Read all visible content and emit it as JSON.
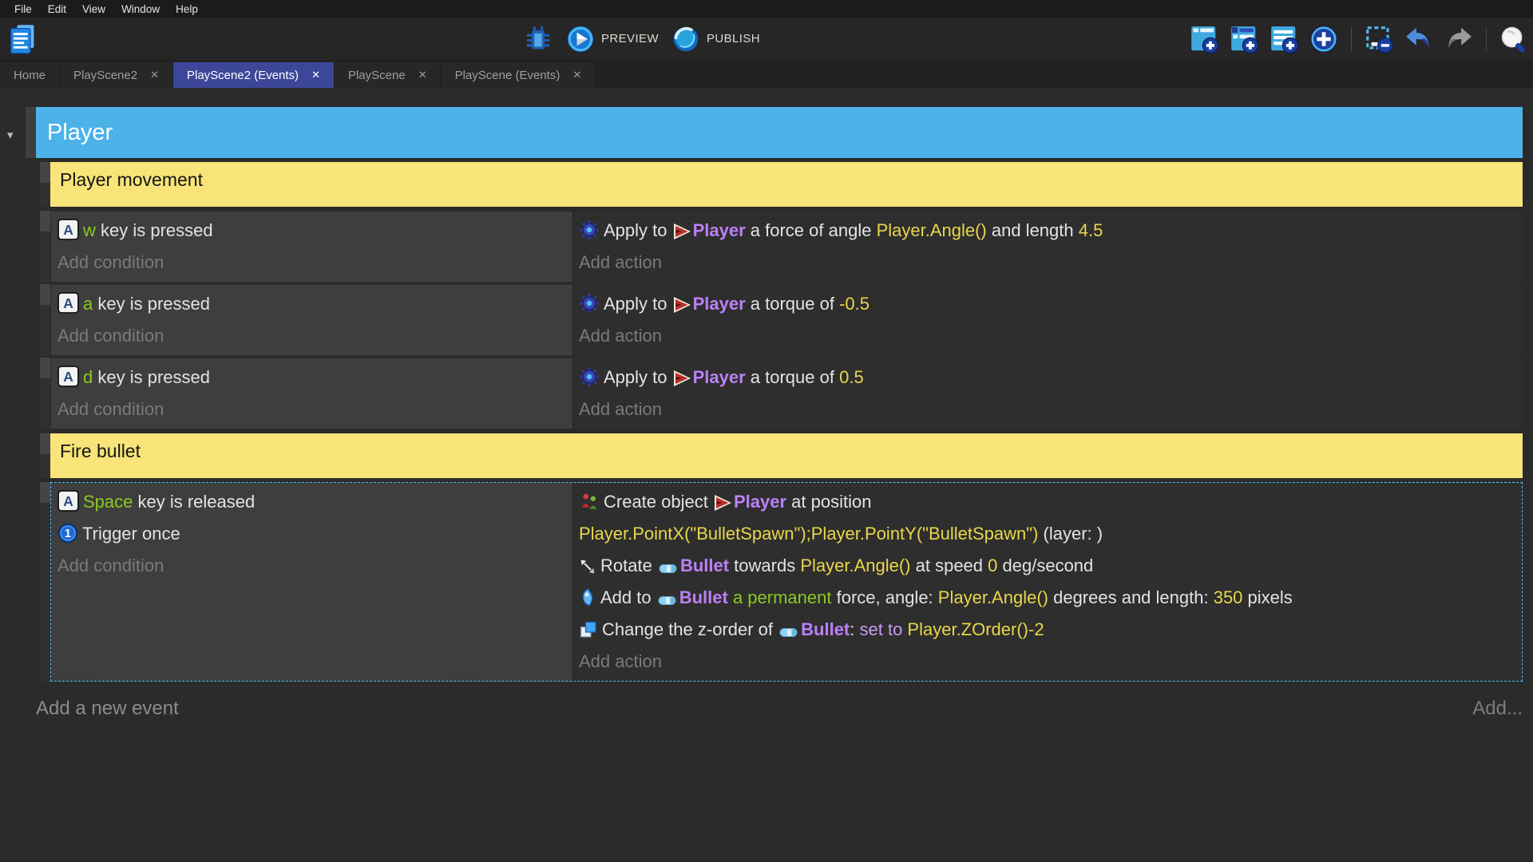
{
  "menu_bar": {
    "items": [
      "File",
      "Edit",
      "View",
      "Window",
      "Help"
    ]
  },
  "toolbar": {
    "project_button_icon": "project-manager",
    "center": [
      {
        "icon": "debug",
        "label": ""
      },
      {
        "icon": "preview",
        "label": "PREVIEW"
      },
      {
        "icon": "publish",
        "label": "PUBLISH"
      }
    ],
    "right": [
      {
        "icon": "add-event"
      },
      {
        "icon": "add-subevent"
      },
      {
        "icon": "add-comment"
      },
      {
        "icon": "add-circle"
      },
      {
        "sep": true
      },
      {
        "icon": "remove-selection"
      },
      {
        "icon": "undo"
      },
      {
        "icon": "redo",
        "disabled": true
      },
      {
        "sep": true
      },
      {
        "icon": "search"
      }
    ]
  },
  "tabs": [
    {
      "label": "Home",
      "closable": false,
      "active": false
    },
    {
      "label": "PlayScene2",
      "closable": true,
      "active": false
    },
    {
      "label": "PlayScene2 (Events)",
      "closable": true,
      "active": true
    },
    {
      "label": "PlayScene",
      "closable": true,
      "active": false
    },
    {
      "label": "PlayScene (Events)",
      "closable": true,
      "active": false
    }
  ],
  "sheet": {
    "group_title": "Player",
    "footer_left": "Add a new event",
    "footer_right": "Add...",
    "add_condition_label": "Add condition",
    "add_action_label": "Add action",
    "items": [
      {
        "type": "comment",
        "text": "Player movement"
      },
      {
        "type": "event",
        "selected": false,
        "conditions": [
          [
            {
              "icon": "keyboard"
            },
            {
              "t": "w",
              "c": "g"
            },
            {
              "t": " key is pressed"
            }
          ]
        ],
        "actions": [
          [
            {
              "icon": "physics"
            },
            {
              "t": "Apply to "
            },
            {
              "icon": "player"
            },
            {
              "t": "Player",
              "c": "o"
            },
            {
              "t": " a force of angle "
            },
            {
              "t": "Player.Angle()",
              "c": "y"
            },
            {
              "t": " and length "
            },
            {
              "t": "4.5",
              "c": "y"
            }
          ]
        ]
      },
      {
        "type": "event",
        "selected": false,
        "conditions": [
          [
            {
              "icon": "keyboard"
            },
            {
              "t": "a",
              "c": "g"
            },
            {
              "t": " key is pressed"
            }
          ]
        ],
        "actions": [
          [
            {
              "icon": "physics"
            },
            {
              "t": "Apply to "
            },
            {
              "icon": "player"
            },
            {
              "t": "Player",
              "c": "o"
            },
            {
              "t": " a torque of "
            },
            {
              "t": "-0.5",
              "c": "y"
            }
          ]
        ]
      },
      {
        "type": "event",
        "selected": false,
        "conditions": [
          [
            {
              "icon": "keyboard"
            },
            {
              "t": "d",
              "c": "g"
            },
            {
              "t": " key is pressed"
            }
          ]
        ],
        "actions": [
          [
            {
              "icon": "physics"
            },
            {
              "t": "Apply to "
            },
            {
              "icon": "player"
            },
            {
              "t": "Player",
              "c": "o"
            },
            {
              "t": " a torque of "
            },
            {
              "t": "0.5",
              "c": "y"
            }
          ]
        ]
      },
      {
        "type": "comment",
        "text": "Fire bullet"
      },
      {
        "type": "event",
        "selected": true,
        "conditions": [
          [
            {
              "icon": "keyboard"
            },
            {
              "t": "Space",
              "c": "g"
            },
            {
              "t": " key is released"
            }
          ],
          [
            {
              "icon": "trigger"
            },
            {
              "t": "Trigger once"
            }
          ]
        ],
        "actions": [
          [
            {
              "icon": "create"
            },
            {
              "t": "Create object "
            },
            {
              "icon": "player"
            },
            {
              "t": "Player",
              "c": "o"
            },
            {
              "t": " at position"
            }
          ],
          [
            {
              "t": "Player.PointX(\"BulletSpawn\");Player.PointY(\"BulletSpawn\")",
              "c": "y"
            },
            {
              "t": " (layer: )"
            }
          ],
          [
            {
              "icon": "rotate"
            },
            {
              "t": "Rotate "
            },
            {
              "icon": "bullet"
            },
            {
              "t": "Bullet",
              "c": "o"
            },
            {
              "t": " towards "
            },
            {
              "t": "Player.Angle()",
              "c": "y"
            },
            {
              "t": " at speed "
            },
            {
              "t": "0",
              "c": "y"
            },
            {
              "t": " deg/second"
            }
          ],
          [
            {
              "icon": "force"
            },
            {
              "t": "Add to "
            },
            {
              "icon": "bullet"
            },
            {
              "t": "Bullet",
              "c": "o"
            },
            {
              "t": " a permanent",
              "c": "g"
            },
            {
              "t": " force, angle: "
            },
            {
              "t": "Player.Angle()",
              "c": "y"
            },
            {
              "t": " degrees and length: "
            },
            {
              "t": "350",
              "c": "y"
            },
            {
              "t": " pixels"
            }
          ],
          [
            {
              "icon": "zorder"
            },
            {
              "t": "Change the z-order of "
            },
            {
              "icon": "bullet"
            },
            {
              "t": "Bullet",
              "c": "o"
            },
            {
              "t": ": "
            },
            {
              "t": "set to ",
              "c": "v"
            },
            {
              "t": "Player.ZOrder()-2",
              "c": "y"
            }
          ]
        ]
      }
    ]
  },
  "colors": {
    "accent_blue": "#4cb2e8",
    "comment_yellow": "#f8e478",
    "tab_active": "#3c4799",
    "selection_cyan": "#4fc3f7",
    "text_green": "#8bc920",
    "text_yellow": "#e9d64a",
    "object_purple": "#bb80f6",
    "violet": "#c79df5"
  }
}
